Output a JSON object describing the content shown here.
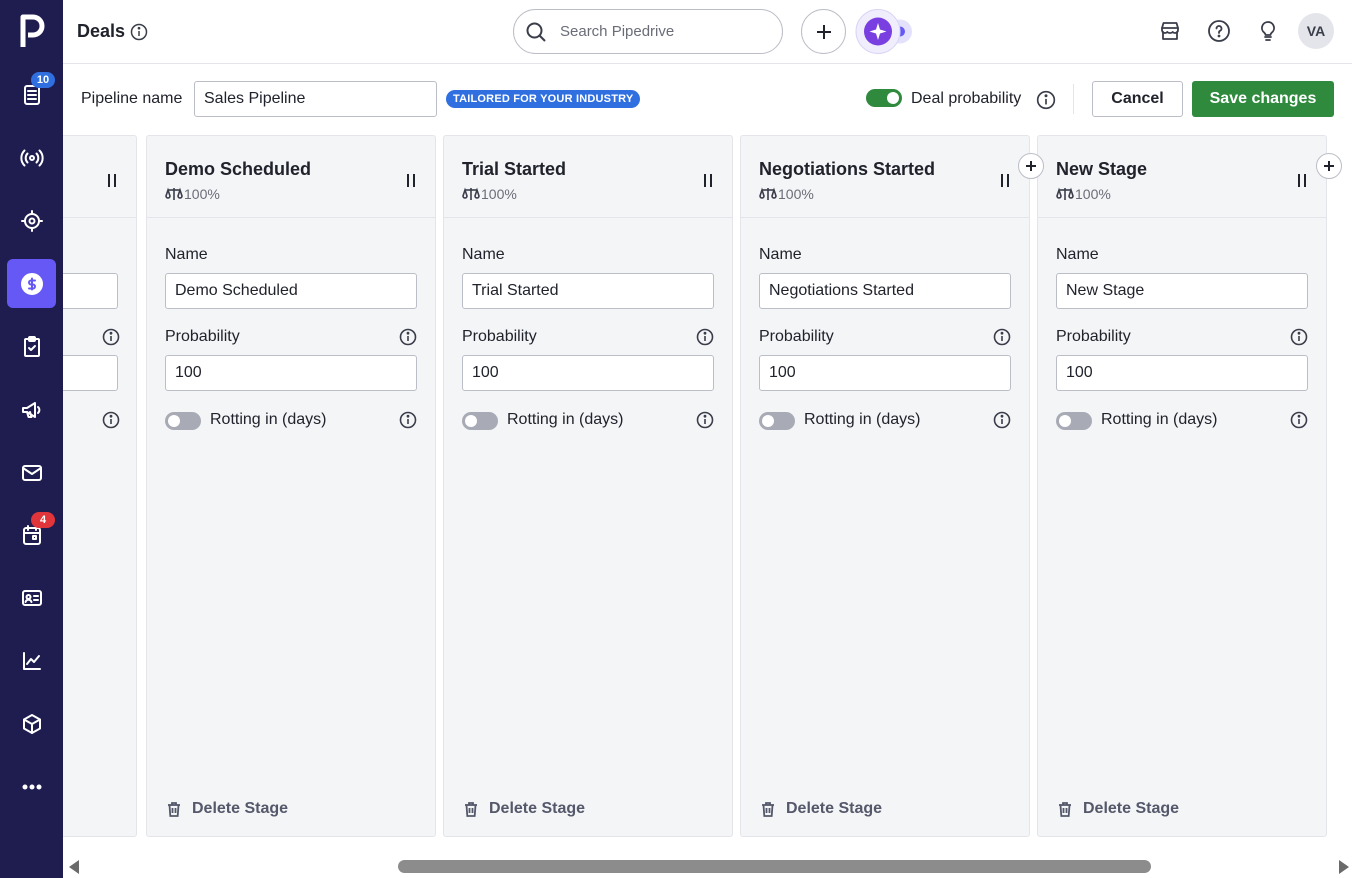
{
  "header": {
    "title": "Deals",
    "search_placeholder": "Search Pipedrive",
    "avatar_initials": "VA"
  },
  "sidebar": {
    "items": [
      {
        "name": "leads-icon",
        "badge": "10"
      },
      {
        "name": "campaigns-broadcast-icon",
        "badge": ""
      },
      {
        "name": "target-icon",
        "badge": ""
      },
      {
        "name": "deals-dollar-icon",
        "badge": "",
        "active": true
      },
      {
        "name": "tasks-clipboard-icon",
        "badge": ""
      },
      {
        "name": "megaphone-icon",
        "badge": ""
      },
      {
        "name": "mail-icon",
        "badge": ""
      },
      {
        "name": "calendar-icon",
        "badge": "4"
      },
      {
        "name": "contacts-card-icon",
        "badge": ""
      },
      {
        "name": "insights-chart-icon",
        "badge": ""
      },
      {
        "name": "products-box-icon",
        "badge": ""
      },
      {
        "name": "more-icon",
        "badge": ""
      }
    ]
  },
  "toolbar": {
    "pipeline_label": "Pipeline name",
    "pipeline_value": "Sales Pipeline",
    "tailored_badge": "TAILORED FOR YOUR INDUSTRY",
    "deal_probability_label": "Deal probability",
    "deal_probability_on": true,
    "cancel_label": "Cancel",
    "save_label": "Save changes"
  },
  "stage_fields": {
    "name_label": "Name",
    "probability_label": "Probability",
    "rotting_label": "Rotting in (days)",
    "delete_label": "Delete Stage"
  },
  "stages": [
    {
      "title": "Demo Scheduled",
      "probability_display": "100%",
      "name_value": "Demo Scheduled",
      "probability_value": "100",
      "rotting_on": false
    },
    {
      "title": "Trial Started",
      "probability_display": "100%",
      "name_value": "Trial Started",
      "probability_value": "100",
      "rotting_on": false
    },
    {
      "title": "Negotiations Started",
      "probability_display": "100%",
      "name_value": "Negotiations Started",
      "probability_value": "100",
      "rotting_on": false
    },
    {
      "title": "New Stage",
      "probability_display": "100%",
      "name_value": "New Stage",
      "probability_value": "100",
      "rotting_on": false
    }
  ],
  "colors": {
    "sidebar_bg": "#1f1d4f",
    "active_nav": "#6558f5",
    "save_green": "#2f8a3e",
    "badge_blue": "#2f6fe0",
    "badge_red": "#e0353a"
  }
}
